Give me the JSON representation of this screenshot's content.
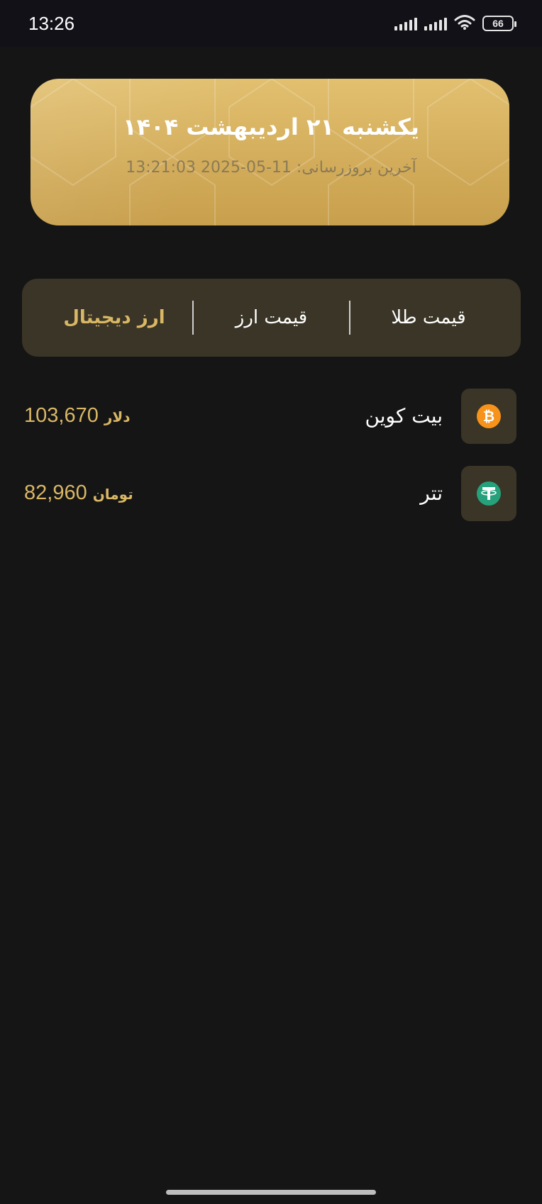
{
  "status_bar": {
    "time": "13:26",
    "battery": "66",
    "icons": [
      "signal-icon",
      "signal-icon",
      "wifi-icon",
      "battery-icon"
    ]
  },
  "date_card": {
    "title": "یکشنبه ۲۱ اردیبهشت ۱۴۰۴",
    "update_label": "آخرین بروزرسانی:",
    "update_value": "11-05-2025 13:21:03"
  },
  "tabs": [
    {
      "label": "قیمت طلا",
      "active": false
    },
    {
      "label": "قیمت ارز",
      "active": false
    },
    {
      "label": "ارز دیجیتال",
      "active": true
    }
  ],
  "coins": [
    {
      "name": "بیت کوین",
      "price": "103,670",
      "unit": "دلار",
      "icon": "bitcoin-icon",
      "color": "#f7931a"
    },
    {
      "name": "تتر",
      "price": "82,960",
      "unit": "تومان",
      "icon": "tether-icon",
      "color": "#26a17b"
    }
  ],
  "colors": {
    "background": "#151515",
    "accent_gold": "#d9b765",
    "card_gold": "#d3ad5b",
    "tab_bg": "#3a3526"
  }
}
